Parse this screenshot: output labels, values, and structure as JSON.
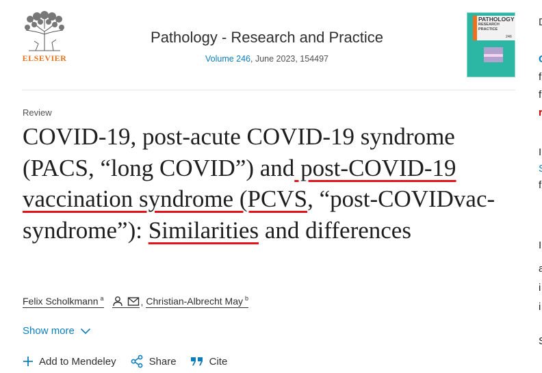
{
  "publisher": {
    "name": "ELSEVIER",
    "logo_icon": "elsevier-tree-logo"
  },
  "journal": {
    "title": "Pathology - Research and Practice",
    "volume_label": "Volume 246",
    "issue_info": ", June 2023, 154497",
    "cover": {
      "title_line1": "PATHOLOGY",
      "title_line2": "RESEARCH",
      "title_line3": "PRACTICE",
      "number": "246"
    }
  },
  "article": {
    "type": "Review",
    "title_parts": [
      "COVID-19, post-acute COVID-19 syndrome (PACS, “long COVID”) and",
      " post-COVID-19 vaccination syndrome (PCVS",
      ", “post-COVIDvac-syndrome”): ",
      "Similarities",
      " and differences"
    ],
    "authors": [
      {
        "name": "Felix Scholkmann",
        "affiliation": "a"
      },
      {
        "name": "Christian-Albrecht May",
        "affiliation": "b"
      }
    ],
    "author_separator": ",",
    "show_more_label": "Show more"
  },
  "actions": {
    "mendeley_label": "Add to Mendeley",
    "share_label": "Share",
    "cite_label": "Cite"
  },
  "colors": {
    "link_blue": "#0c7dbb",
    "brand_orange": "#e9711c",
    "annotation_red": "#e3131b"
  }
}
